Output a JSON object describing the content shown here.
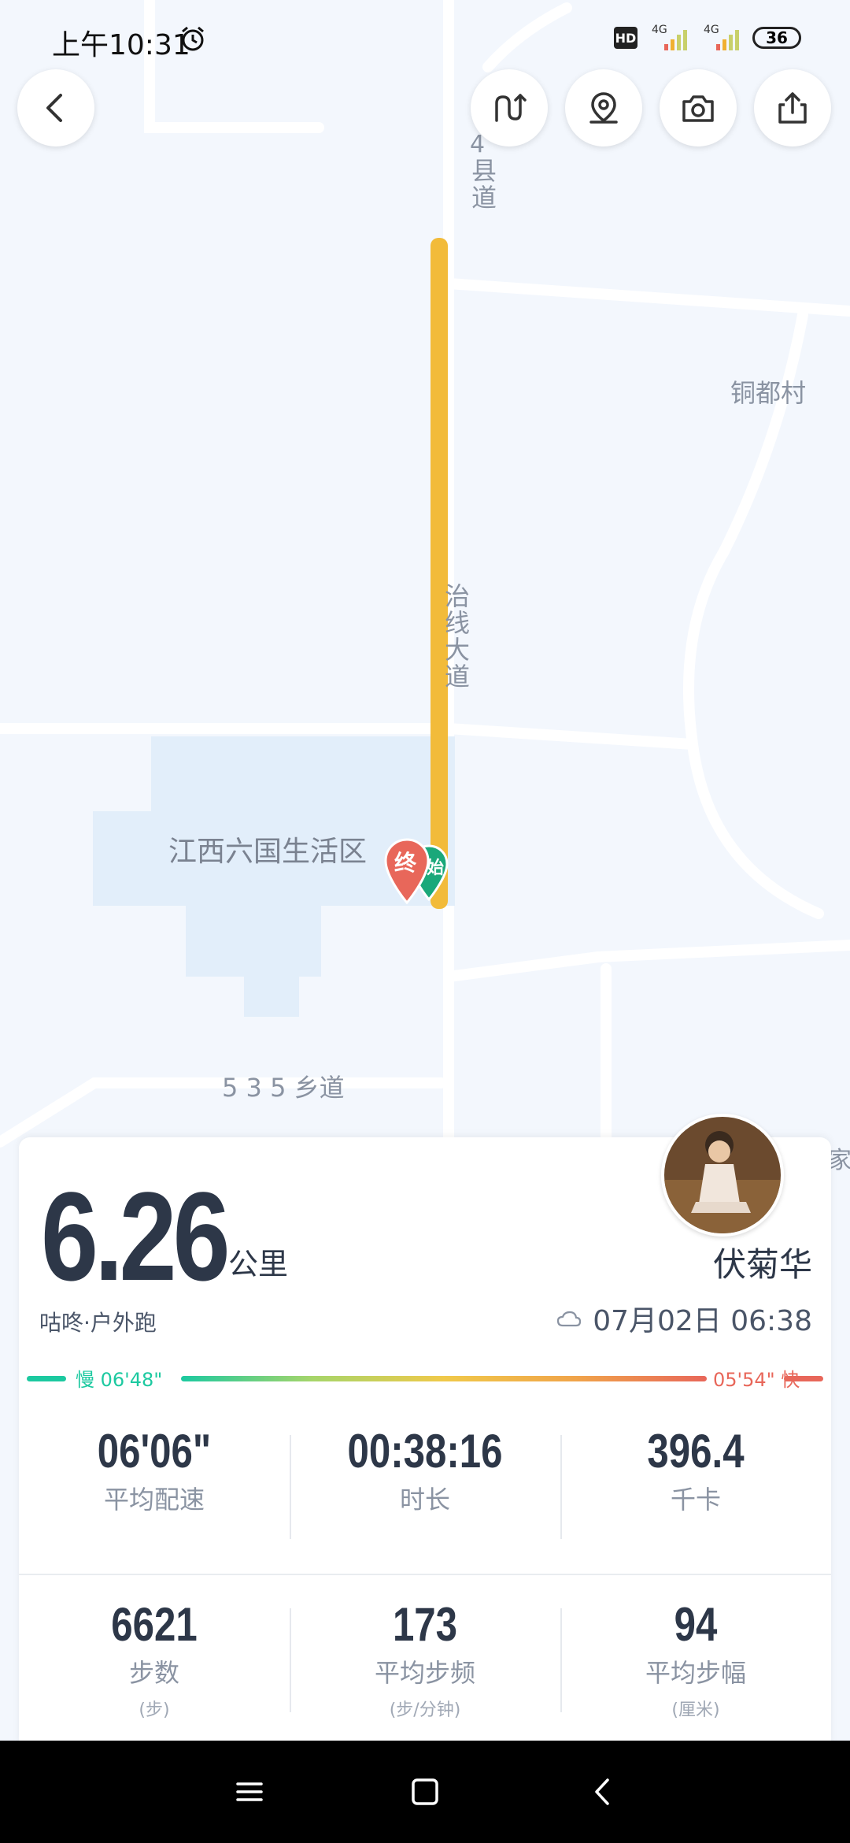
{
  "status_bar": {
    "time": "上午10:31",
    "hd": "HD",
    "signal_1": "4G",
    "signal_2": "4G",
    "battery": "36"
  },
  "map": {
    "labels": {
      "county_road": "县道",
      "county_road_num": "4",
      "village": "铜都村",
      "road_vertical": "治线大道",
      "area": "江西六国生活区",
      "township_road": "5 3 5 乡道",
      "edge_char": "家"
    },
    "markers": {
      "end": "终",
      "start": "始"
    }
  },
  "top_buttons": {
    "back_icon": "chevron-left-icon",
    "route_icon": "route-switch-icon",
    "location_icon": "location-pin-icon",
    "camera_icon": "camera-icon",
    "share_icon": "share-icon"
  },
  "summary": {
    "distance": "6.26",
    "distance_unit": "公里",
    "user_name": "伏菊华",
    "activity_type": "咕咚·户外跑",
    "date": "07月02日 06:38",
    "weather_icon": "cloud-icon",
    "pace_slow": "慢 06'48\"",
    "pace_fast": "05'54\" 快"
  },
  "stats": [
    {
      "value": "06'06\"",
      "label": "平均配速",
      "unit": ""
    },
    {
      "value": "00:38:16",
      "label": "时长",
      "unit": ""
    },
    {
      "value": "396.4",
      "label": "千卡",
      "unit": ""
    },
    {
      "value": "6621",
      "label": "步数",
      "unit": "(步)"
    },
    {
      "value": "173",
      "label": "平均步频",
      "unit": "(步/分钟)"
    },
    {
      "value": "94",
      "label": "平均步幅",
      "unit": "(厘米)"
    }
  ],
  "colors": {
    "route": "#f2bb3a",
    "pace_slow": "#1cc9a0",
    "pace_fast": "#e8675a",
    "end_marker": "#e8675a",
    "start_marker": "#1aa87a"
  }
}
